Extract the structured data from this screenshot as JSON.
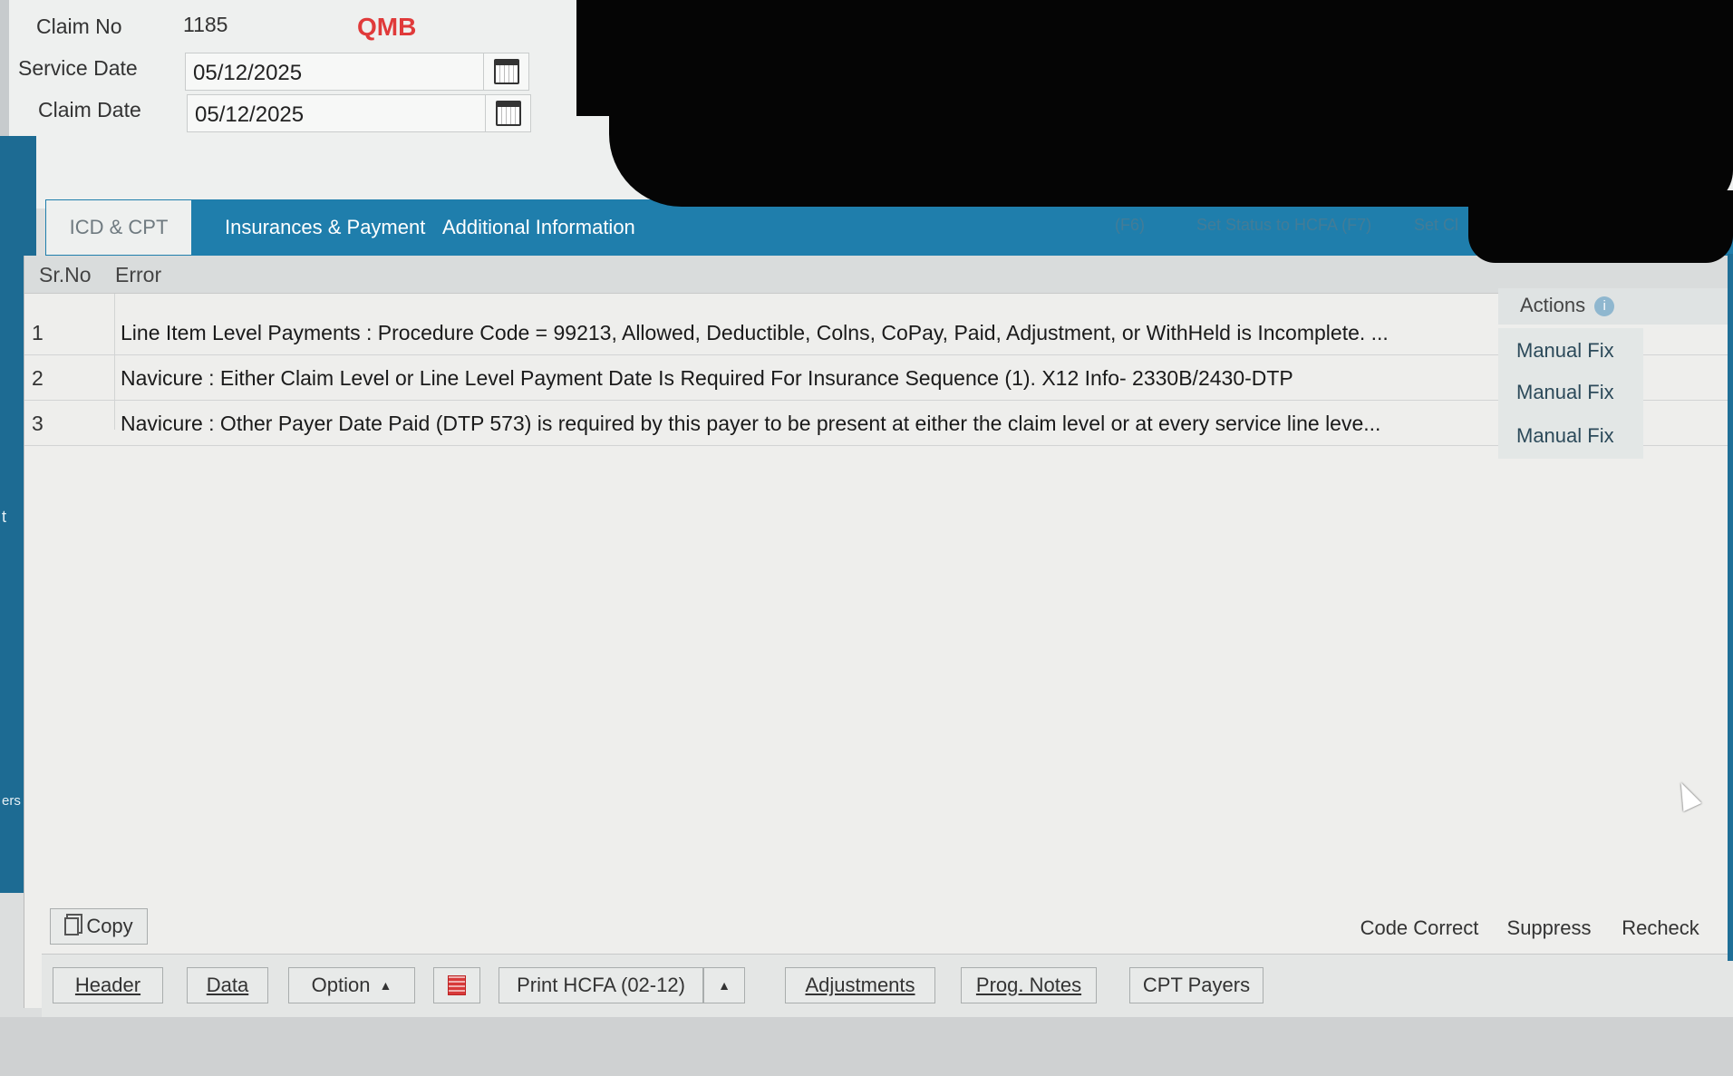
{
  "claim": {
    "claim_no_label": "Claim No",
    "claim_no": "1185",
    "plan": "QMB",
    "service_date_label": "Service Date",
    "service_date": "05/12/2025",
    "claim_date_label": "Claim Date",
    "claim_date": "05/12/2025"
  },
  "tabs": [
    {
      "label": "ICD & CPT",
      "active": true
    },
    {
      "label": "Insurances & Payment",
      "active": false
    },
    {
      "label": "Additional Information",
      "active": false
    }
  ],
  "faded_toolbar": [
    "(F6)",
    "Set Status to HCFA (F7)",
    "Set Cl"
  ],
  "grid": {
    "columns": [
      "Sr.No",
      "Error",
      "Actions"
    ],
    "rows": [
      {
        "sr": "1",
        "error": "Line Item Level Payments : Procedure Code = 99213, Allowed, Deductible, Colns, CoPay, Paid, Adjustment, or WithHeld is Incomplete. ...",
        "action": "Manual Fix"
      },
      {
        "sr": "2",
        "error": "Navicure : Either Claim Level or Line Level Payment Date Is Required For Insurance Sequence (1). X12 Info- 2330B/2430-DTP",
        "action": "Manual Fix"
      },
      {
        "sr": "3",
        "error": "Navicure : Other Payer Date Paid (DTP 573) is required by this payer to be present at either the claim level or at every service line leve...",
        "action": "Manual Fix"
      }
    ]
  },
  "panel_buttons": {
    "copy": "Copy",
    "code_correct": "Code Correct",
    "suppress": "Suppress",
    "recheck": "Recheck"
  },
  "toolbar": {
    "header": "Header",
    "data": "Data",
    "option": "Option",
    "print": "Print HCFA (02-12)",
    "adjustments": "Adjustments",
    "prog_notes": "Prog. Notes",
    "cpt_payers": "CPT Payers"
  },
  "left_fragments": [
    "t",
    "ers"
  ]
}
